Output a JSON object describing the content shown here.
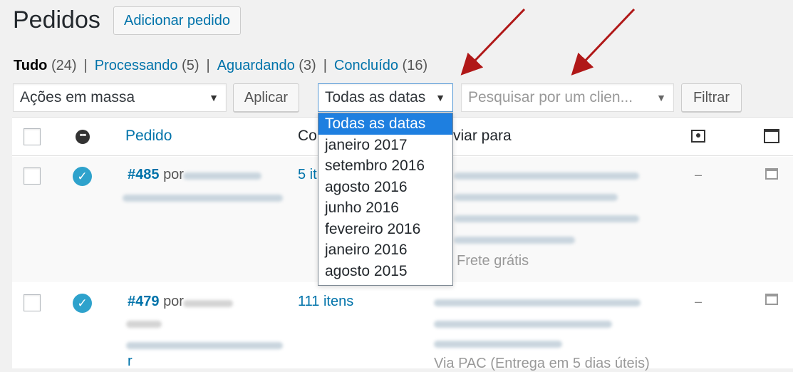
{
  "header": {
    "title": "Pedidos",
    "add_button": "Adicionar pedido"
  },
  "filters_tabs": [
    {
      "label": "Tudo",
      "count": "(24)"
    },
    {
      "label": "Processando",
      "count": "(5)"
    },
    {
      "label": "Aguardando",
      "count": "(3)"
    },
    {
      "label": "Concluído",
      "count": "(16)"
    }
  ],
  "separator": "|",
  "toolbar": {
    "bulk_actions": "Ações em massa",
    "apply_label": "Aplicar",
    "date_filter": "Todas as datas",
    "customer_search_placeholder": "Pesquisar por um clien...",
    "filter_label": "Filtrar",
    "arrow_glyph": "▼"
  },
  "date_options": [
    "Todas as datas",
    "janeiro 2017",
    "setembro 2016",
    "agosto 2016",
    "junho 2016",
    "fevereiro 2016",
    "janeiro 2016",
    "agosto 2015"
  ],
  "columns": {
    "order": "Pedido",
    "purchased_partial": "Co",
    "ship_to_partial": "viar para"
  },
  "rows": [
    {
      "order": "#485",
      "by": "por",
      "items": "5 it",
      "shipping_method": "Frete grátis",
      "dash": "–"
    },
    {
      "order": "#479",
      "by": "por",
      "items": "111 itens",
      "shipping_method": "Via PAC (Entrega em 5 dias úteis)",
      "dash": "–",
      "extra": "r"
    }
  ],
  "icons": {
    "status_header": "more-icon",
    "status_done": "check-icon",
    "check_glyph": "✓",
    "more_glyph": "•••"
  },
  "colors": {
    "link": "#0073aa",
    "selected_option": "#1e7fe0",
    "status_done": "#2ea2cc",
    "annotation_arrow": "#b01818"
  }
}
